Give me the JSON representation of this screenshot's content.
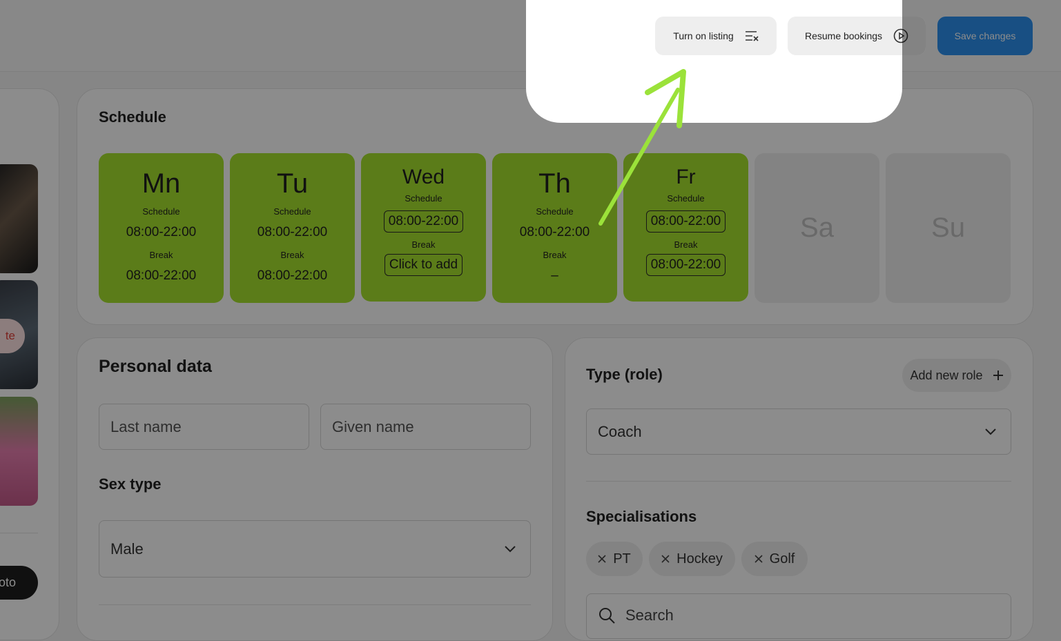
{
  "header": {
    "turn_on_listing": "Turn on listing",
    "resume_bookings": "Resume bookings",
    "save_changes": "Save changes"
  },
  "left_panel": {
    "delete_label": "te",
    "photo_label": "oto"
  },
  "schedule": {
    "title": "Schedule",
    "days": [
      {
        "name": "Mn",
        "schedule_label": "Schedule",
        "schedule": "08:00-22:00",
        "break_label": "Break",
        "break": "08:00-22:00"
      },
      {
        "name": "Tu",
        "schedule_label": "Schedule",
        "schedule": "08:00-22:00",
        "break_label": "Break",
        "break": "08:00-22:00"
      },
      {
        "name": "Wed",
        "schedule_label": "Schedule",
        "schedule": "08:00-22:00",
        "break_label": "Break",
        "break": "Click to add"
      },
      {
        "name": "Th",
        "schedule_label": "Schedule",
        "schedule": "08:00-22:00",
        "break_label": "Break",
        "break": "–"
      },
      {
        "name": "Fr",
        "schedule_label": "Schedule",
        "schedule": "08:00-22:00",
        "break_label": "Break",
        "break": "08:00-22:00"
      },
      {
        "name": "Sa"
      },
      {
        "name": "Su"
      }
    ]
  },
  "personal": {
    "title": "Personal data",
    "last_name_placeholder": "Last name",
    "given_name_placeholder": "Given name",
    "sex_title": "Sex type",
    "sex_value": "Male"
  },
  "role": {
    "title": "Type (role)",
    "add_role": "Add new role",
    "role_value": "Coach",
    "specialisations_title": "Specialisations",
    "chips": [
      "PT",
      "Hockey",
      "Golf"
    ],
    "search_placeholder": "Search"
  },
  "colors": {
    "day_active": "#a6e22e",
    "save_button": "#2c90ee",
    "arrow": "#9be23a"
  }
}
